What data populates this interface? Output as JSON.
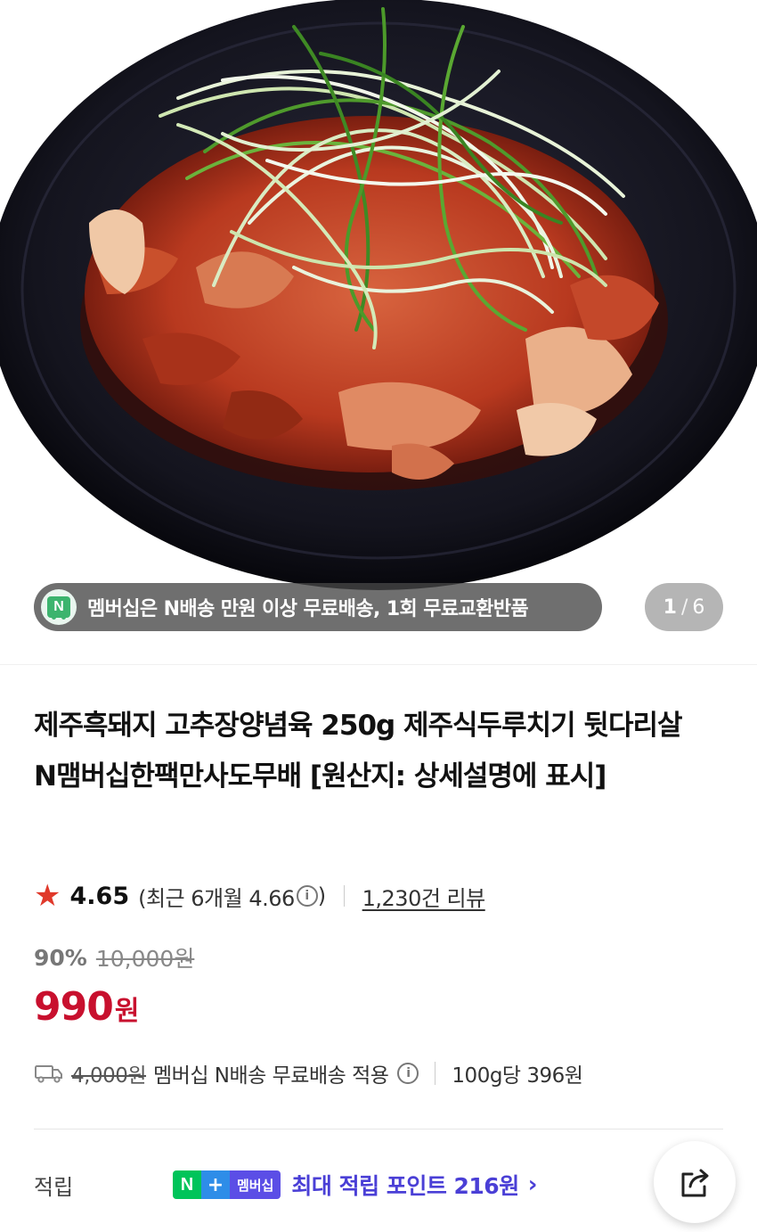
{
  "hero": {
    "image_alt": "food-photo",
    "promo_text": "멤버십은 N배송 만원 이상 무료배송, 1회 무료교환반품",
    "promo_logo_letter": "N",
    "counter_current": "1",
    "counter_sep": "/",
    "counter_total": "6"
  },
  "product": {
    "title": "제주흑돼지 고추장양념육 250g 제주식두루치기 뒷다리살 N맴버십한팩만사도무배 [원산지: 상세설명에 표시]",
    "rating": "4.65",
    "recent_rating": "(최근 6개월 4.66",
    "recent_close": ")",
    "review_count": "1,230건 리뷰",
    "discount_percent": "90%",
    "original_price": "10,000원",
    "price": "990",
    "price_unit": "원",
    "shipping_original": "4,000원",
    "shipping_text": "멤버십 N배송 무료배송 적용",
    "unit_price": "100g당 396원"
  },
  "points": {
    "label": "적립",
    "badge_n": "N",
    "badge_plus": "+",
    "badge_membership": "멤버십",
    "text": "최대 적립 포인트 216원",
    "chevron": "›"
  },
  "icons": {
    "star": "★",
    "info": "i"
  },
  "colors": {
    "price_red": "#c8102e",
    "star_red": "#e0392b",
    "points_purple": "#4a3fd6",
    "naver_green": "#00c45a"
  }
}
